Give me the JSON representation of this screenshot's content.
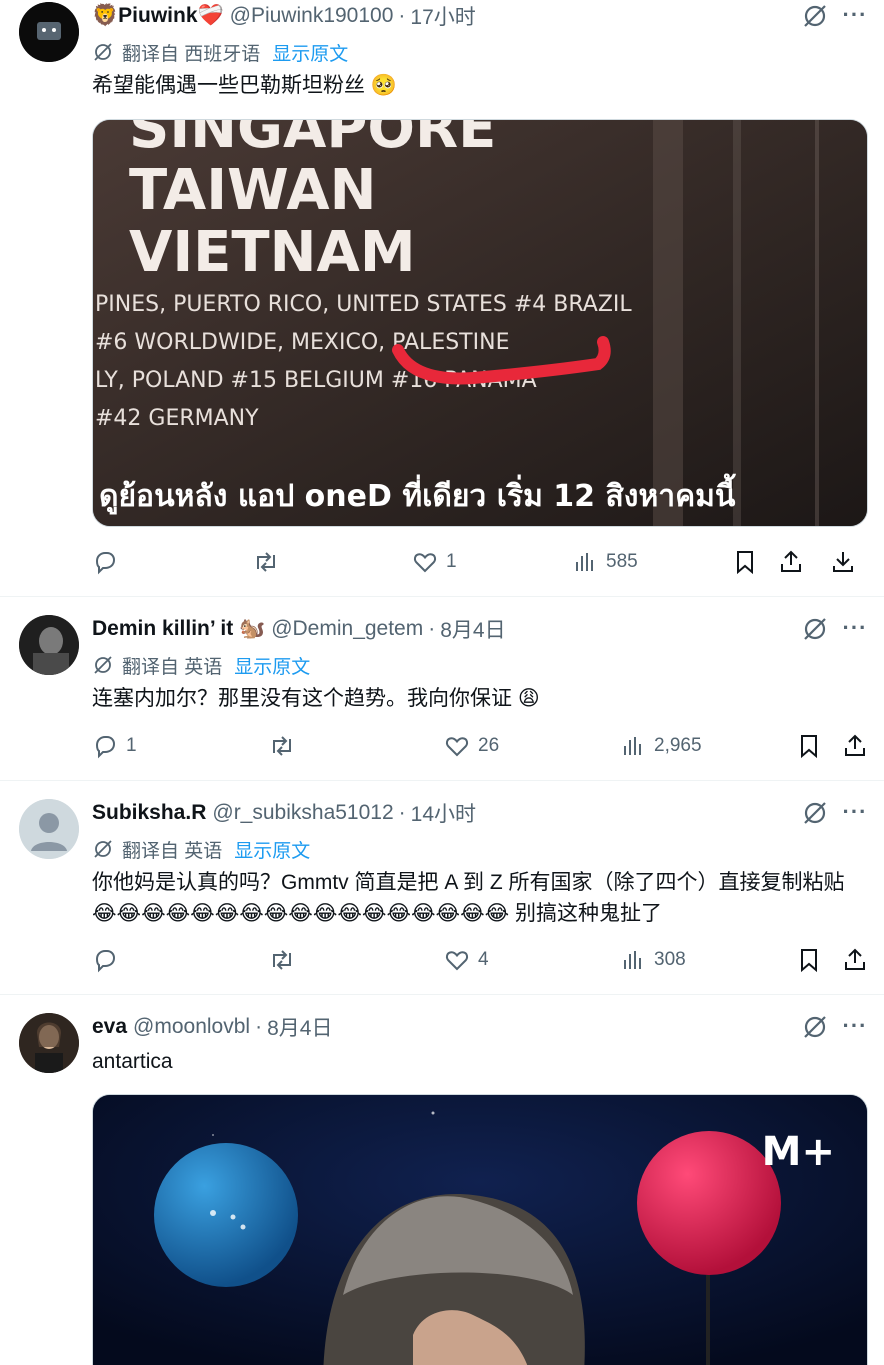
{
  "tweets": [
    {
      "name": "🦁Piuwink❤️‍🩹",
      "handle": "@Piuwink190100",
      "time": "17小时",
      "translate_label": "翻译自 西班牙语",
      "show_original": "显示原文",
      "text": "希望能偶遇一些巴勒斯坦粉丝 🥺",
      "media": {
        "lines_big": [
          "SINGAPORE",
          "TAIWAN",
          "VIETNAM"
        ],
        "lines_small": [
          "PINES, PUERTO RICO, UNITED STATES #4 BRAZIL",
          "#6 WORLDWIDE, MEXICO, PALESTINE",
          "LY, POLAND #15 BELGIUM #16 PANAMA",
          "#42 GERMANY"
        ],
        "footer": "ดูย้อนหลัง แอป oneD ที่เดียว  เริ่ม 12 สิงหาคมนี้"
      },
      "actions": {
        "reply": "",
        "retweet": "",
        "like": "1",
        "views": "585"
      }
    },
    {
      "name": "Demin killin’ it 🐿️",
      "handle": "@Demin_getem",
      "time": "8月4日",
      "translate_label": "翻译自 英语",
      "show_original": "显示原文",
      "text": "连塞内加尔？那里没有这个趋势。我向你保证 😩",
      "actions": {
        "reply": "1",
        "retweet": "",
        "like": "26",
        "views": "2,965"
      }
    },
    {
      "name": "Subiksha.R",
      "handle": "@r_subiksha51012",
      "time": "14小时",
      "translate_label": "翻译自 英语",
      "show_original": "显示原文",
      "text": "你他妈是认真的吗？Gmmtv 简直是把 A 到 Z 所有国家（除了四个）直接复制粘贴😂😂😂😂😂😂😂😂😂😂😂😂😂😂😂😂😂 别搞这种鬼扯了",
      "actions": {
        "reply": "",
        "retweet": "",
        "like": "4",
        "views": "308"
      }
    },
    {
      "name": "eva",
      "handle": "@moonlovbl",
      "time": "8月4日",
      "text": "antartica",
      "media": {
        "watermark": "M+"
      }
    }
  ],
  "colors": {
    "accent": "#1d9bf0",
    "muted": "#536471",
    "text": "#0f1419"
  },
  "icons": [
    "grok-icon",
    "more-icon",
    "translate-icon",
    "reply-icon",
    "retweet-icon",
    "like-icon",
    "views-icon",
    "bookmark-icon",
    "share-icon",
    "download-icon"
  ]
}
